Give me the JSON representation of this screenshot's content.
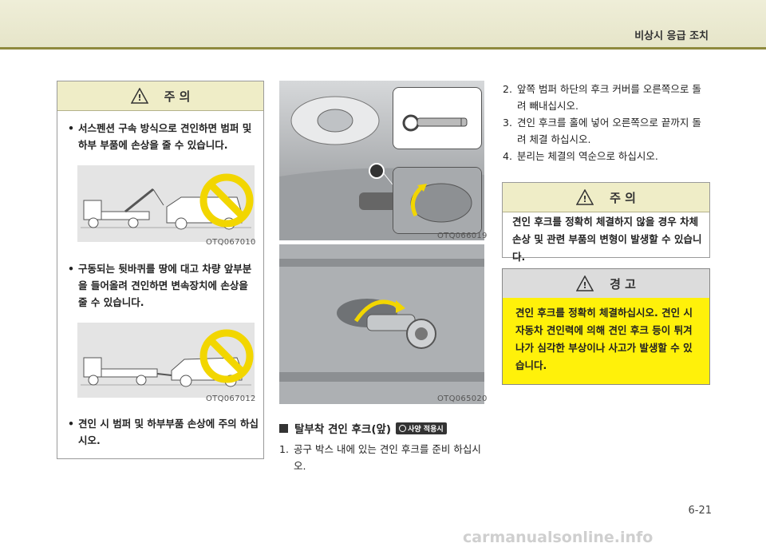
{
  "header": {
    "title": "비상시 응급 조치"
  },
  "left_caution": {
    "heading": "주  의",
    "bullets": [
      "서스펜션 구속 방식으로 견인하면 범퍼 및 하부 부품에 손상을 줄 수 있습니다.",
      "구동되는 뒷바퀴를 땅에 대고 차량 앞부분을 들어올려 견인하면 변속장치에 손상을 줄 수 있습니다.",
      "견인 시 범퍼 및 하부부품 손상에 주의 하십시오."
    ],
    "fig1_code": "OTQ067010",
    "fig2_code": "OTQ067012"
  },
  "middle": {
    "photo1_code": "OTQ066019",
    "photo2_code": "OTQ065020",
    "section_title": "탈부착 견인 후크(앞)",
    "option_badge": "사양 적용시",
    "step1_num": "1.",
    "step1_text": "공구 박스 내에 있는 견인 후크를 준비 하십시오."
  },
  "right": {
    "steps": [
      {
        "num": "2.",
        "text": "앞쪽 범퍼 하단의 후크 커버를 오른쪽으로 돌려 빼내십시오."
      },
      {
        "num": "3.",
        "text": "견인 후크를 홀에 넣어 오른쪽으로 끝까지 돌려 체결 하십시오."
      },
      {
        "num": "4.",
        "text": "분리는 체결의 역순으로 하십시오."
      }
    ],
    "caution_heading": "주  의",
    "caution_text": "견인 후크를 정확히 체결하지 않을 경우 차체 손상 및 관련 부품의 변형이 발생할 수 있습니다.",
    "warning_heading": "경  고",
    "warning_text": "견인 후크를 정확히 체결하십시오. 견인 시 자동차 견인력에 의해 견인 후크 등이 튀겨 나가 심각한 부상이나 사고가 발생할 수 있습니다."
  },
  "page_number": "6-21",
  "watermark": "carmanualsonline.info",
  "colors": {
    "header_band": "#e6e5c9",
    "header_line": "#8f8a3e",
    "caution_head": "#efedc7",
    "warning_body": "#fff10a",
    "prohibit_sign": "#f2d600"
  }
}
